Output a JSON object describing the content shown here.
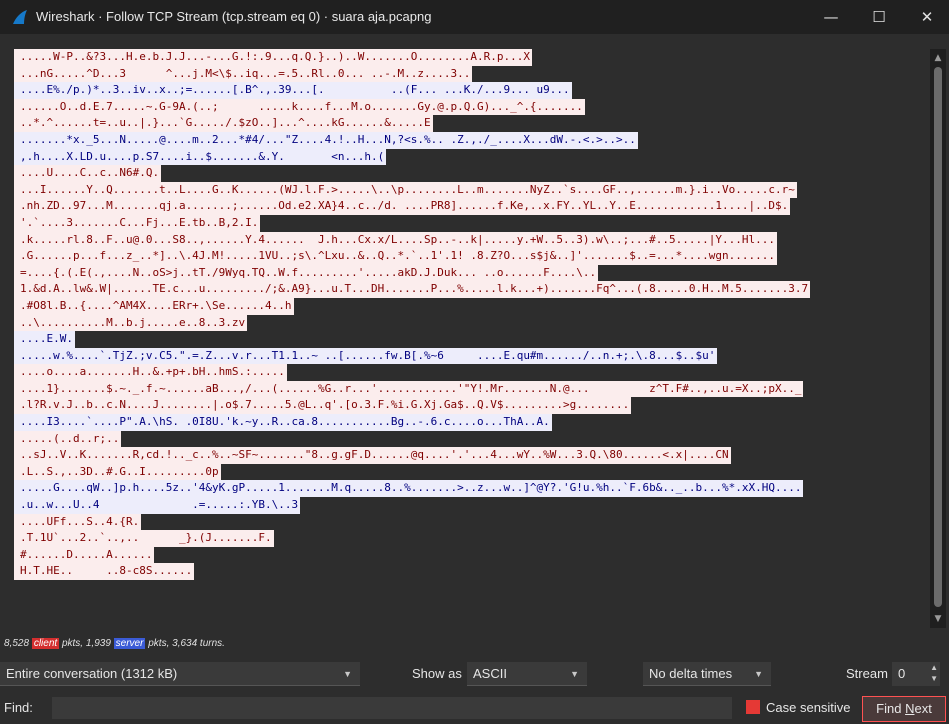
{
  "window": {
    "title": "Wireshark · Follow TCP Stream (tcp.stream eq 0) · suara aja.pcapng",
    "minimize": "—",
    "maximize": "☐",
    "close": "✕"
  },
  "stream_lines": [
    {
      "dir": "client",
      "text": ".....W-P..&?3...H.e.b.J.J...-...G.!:.9...q.Q.}..)..W.......O........A.R.p...X"
    },
    {
      "dir": "client",
      "text": "...nG.....^D...3      ^...j.M<\\$..iq...=.5..Rl..0... ..-.M..z....3.."
    },
    {
      "dir": "server",
      "text": "....E%./p.)*..3..iv..x..;=......[.B^.,.39...[.          ..(F... ...K./...9... u9..."
    },
    {
      "dir": "client",
      "text": "......O..d.E.7.....~.G-9A.(..;      .....k....f...M.o.......Gy.@.p.Q.G)..._^.{......."
    },
    {
      "dir": "client",
      "text": "..*.^......t=..u..|.}...`G...../.$zO..]...^....kG......&.....E"
    },
    {
      "dir": "server",
      "text": ".......*x._5...N.....@....m..2...*#4/...\"Z....4.!..H...N,?<s.%.. .Z.,./_....X...dW.-.<.>..>.."
    },
    {
      "dir": "server",
      "text": ",.h....X.LD.u....p.S7....i..$.......&.Y.       <n...h.("
    },
    {
      "dir": "client",
      "text": "....U....C..c..N6#.Q."
    },
    {
      "dir": "client",
      "text": "...I......Y..Q.......t..L....G..K......(WJ.l.F.>.....\\..\\p........L..m.......NyZ..`s....GF..,......m.}.i..Vo.....c.r~"
    },
    {
      "dir": "client",
      "text": ".nh.ZD..97...M.......qj.a.......;......Od.e2.XA}4..c../d. ....PR8]......f.Ke,..x.FY..YL..Y..E............1....|..D$."
    },
    {
      "dir": "client",
      "text": "'.`....3.......C...Fj...E.tb..B,2.I."
    },
    {
      "dir": "client",
      "text": ".k.....rl.8..F..u@.0...S8..,......Y.4......  J.h...Cx.x/L....Sp..-..k|.....y.+W..5..3).w\\..;...#..5.....|Y...Hl..."
    },
    {
      "dir": "client",
      "text": ".G......p...f...z_..*]..\\.4J.M!.....1VU..;s\\.^Lxu..&..Q..*.`..1'.1! .8.Z?O...s$j&..]'.......$..=...*....wgn......."
    },
    {
      "dir": "client",
      "text": "=....{.(.E(.,....N..oS>j..tT./9Wyq.TQ..W.f.........'.....akD.J.Duk... ..o......F....\\.."
    },
    {
      "dir": "client",
      "text": "1.&d.A..lw&.W|......TE.c...u........./;&.A9}...u.T...DH.......P...%.....l.k...+).......Fq^...(.8.....0.H..M.5.......3.7"
    },
    {
      "dir": "client",
      "text": ".#O8l.B..{....^AM4X....ERr+.\\Se......4..h"
    },
    {
      "dir": "client",
      "text": "..\\..........M..b.j.....e..8..3.zv"
    },
    {
      "dir": "server",
      "text": "....E.W."
    },
    {
      "dir": "server",
      "text": ".....w.%....`.TjZ.;v.C5.\".=.Z...v.r...T1.1..~ ..[......fw.B[.%~6     ....E.qu#m....../..n.+;.\\.8...$..$u'"
    },
    {
      "dir": "client",
      "text": "....o....a.......H..&.+p+.bH..hmS.:....."
    },
    {
      "dir": "client",
      "text": "....1}.......$.~._.f.~......aB...,/...(......%G..r...'............'\"Y!.Mr.......N.@...         z^T.F#..,..u.=X..;pX.._"
    },
    {
      "dir": "client",
      "text": ".l?R.v.J..b..c.N....J........|.o$.7.....5.@L..q'.[o.3.F.%i.G.Xj.Ga$..Q.V$.........>g........"
    },
    {
      "dir": "server",
      "text": "....I3....`....P\".A.\\hS. .0I8U.'k.~y..R..ca.8...........Bg..-.6.c....o...ThA..A."
    },
    {
      "dir": "client",
      "text": ".....(..d..r;.."
    },
    {
      "dir": "client",
      "text": "..sJ..V..K.......R,cd.!.._c..%..~SF~.......\"8..g.gF.D......@q....'.'...4...wY..%W...3.Q.\\80......<.x|....CN"
    },
    {
      "dir": "client",
      "text": ".L..S.,..3D..#.G..I.........0p"
    },
    {
      "dir": "server",
      "text": ".....G....qW..]p.h....5z..'4&yK.gP.....1.......M.q.....8..%.......>..z...w..]^@Y?.'G!u.%h..`F.6b&.._..b...%*.xX.HQ...."
    },
    {
      "dir": "server",
      "text": ".u..w...U..4              .=.....:.YB.\\..3"
    },
    {
      "dir": "client",
      "text": "....UFf...S..4.{R."
    },
    {
      "dir": "client",
      "text": ".T.1U`...2..`..,..      _}.(J.......F."
    },
    {
      "dir": "client",
      "text": "#......D.....A......"
    },
    {
      "dir": "client",
      "text": "H.T.HE..     ..8-c8S......"
    }
  ],
  "stats": {
    "client_count": "8,528",
    "client_tag": "client",
    "pkts_mid": "pkts, 1,939",
    "server_tag": "server",
    "pkts_end": "pkts, 3,634 turns."
  },
  "controls": {
    "conversation": "Entire conversation (1312 kB)",
    "show_as_label": "Show as",
    "show_as_value": "ASCII",
    "delta": "No delta times",
    "stream_label": "Stream",
    "stream_value": "0",
    "find_label": "Find:",
    "find_value": "",
    "case_sensitive": "Case sensitive",
    "find_next_prefix": "Find ",
    "find_next_underlined": "N",
    "find_next_suffix": "ext"
  },
  "colors": {
    "client_bg": "#fbeded",
    "client_fg": "#7f0000",
    "server_bg": "#ededfb",
    "server_fg": "#00007f",
    "accent": "#e53935"
  }
}
